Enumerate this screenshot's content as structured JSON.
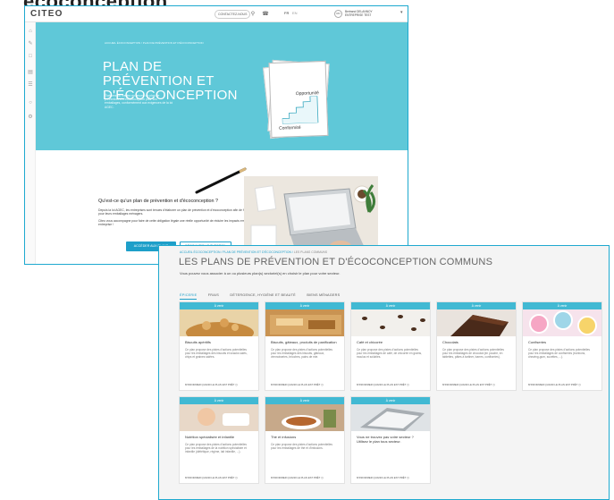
{
  "page_heading_clipped": "écoconception",
  "app": {
    "logo": "CITEO",
    "topbar": {
      "contact": "CONTACTEZ-NOUS",
      "lang_active": "FR",
      "lang_other": "EN",
      "avatar_initials": "RD",
      "user_name": "Bertrand DELANNOY",
      "user_org": "ENTREPRISE TEST",
      "icons": [
        "search-icon",
        "phone-icon",
        "menu-icon"
      ]
    },
    "sidebar_icons": [
      "home-icon",
      "pen-icon",
      "document-icon",
      "file-icon",
      "chart-icon",
      "help-icon",
      "settings-icon"
    ]
  },
  "hero": {
    "breadcrumb": "ACCUEIL ÉCOCONCEPTION / PLAN DE PRÉVENTION ET D'ÉCOCONCEPTION",
    "title": "PLAN DE PRÉVENTION ET D'ÉCOCONCEPTION",
    "description": "Élaborez ou mettez en œuvre un plan de prévention et d'écoconception pour vos emballages, conformément aux exigences de la loi AGEC.",
    "paper_label_top": "Opportunité",
    "paper_label_bottom": "Conformité"
  },
  "intro": {
    "title": "Qu'est-ce qu'un plan de prévention et d'écoconception ?",
    "p1": "Depuis la loi AGEC, les entreprises sont tenues d'élaborer un plan de prévention et d'écoconception afin de formaliser une démarche pour leurs emballages ménagers.",
    "p2": "Citeo vous accompagne pour faire de cette obligation légale une réelle opportunité de réduire les impacts environnementaux de votre entreprise !",
    "btn_primary": "ACCÉDER AUX PLANS",
    "btn_secondary": "DÉCOUVRIR LE TUTORIEL"
  },
  "plans": {
    "breadcrumb_prefix": "ACCUEIL ÉCOCONCEPTION / PLAN DE PRÉVENTION ET D'ÉCOCONCEPTION / ",
    "breadcrumb_current": "LES PLANS COMMUNS",
    "title": "LES PLANS DE PRÉVENTION ET D'ÉCOCONCEPTION COMMUNS",
    "subtitle": "Vous pouvez vous associer à un ou plusieurs plan(s) sectoriel(s) en choisir le plan pour votre secteur.",
    "tabs": [
      {
        "label": "ÉPICERIE",
        "active": true
      },
      {
        "label": "FRAIS",
        "active": false
      },
      {
        "label": "DÉTERGENCE, HYGIÈNE ET BEAUTÉ",
        "active": false
      },
      {
        "label": "BIENS MÉNAGERS",
        "active": false
      }
    ],
    "badge": "À venir",
    "footer": "M'INFORMER QUAND LE PLAN EST PRÊT",
    "cards": [
      {
        "name": "Biscuits apéritifs",
        "desc": "Ce plan propose des pistes d'actions potentielles pour les emballages des biscuits et snacks salés, chips et graines salées."
      },
      {
        "name": "Biscuits, gâteaux, produits de panification",
        "desc": "Ce plan propose des pistes d'actions potentielles pour les emballages des biscuits, gâteaux, viennoiseries, brioches, pains de mie."
      },
      {
        "name": "Café et chicorée",
        "desc": "Ce plan propose des pistes d'actions potentielles pour les emballages de café, de chicorée en grains, moulus et solubles."
      },
      {
        "name": "Chocolats",
        "desc": "Ce plan propose des pistes d'actions potentielles pour les emballages de chocolat (en poudre, en tablettes, pâtes à tartiner, barres, confiseries)."
      },
      {
        "name": "Confiseries",
        "desc": "Ce plan propose des pistes d'actions potentielles pour les emballages de confiseries (bonbons, chewing-gum, sucettes, ...)."
      },
      {
        "name": "Nutrition spécialisée et infantile",
        "desc": "Ce plan propose des pistes d'actions potentielles pour les emballages de la nutrition spécialisée et infantile (diététique, régime, lait infantile, ...)."
      },
      {
        "name": "Thé et infusions",
        "desc": "Ce plan propose des pistes d'actions potentielles pour les emballages de thé et d'infusions."
      },
      {
        "name": "Vous ne trouvez pas votre secteur ? Utilisez le plan tous secteur.",
        "desc": ""
      }
    ]
  }
}
